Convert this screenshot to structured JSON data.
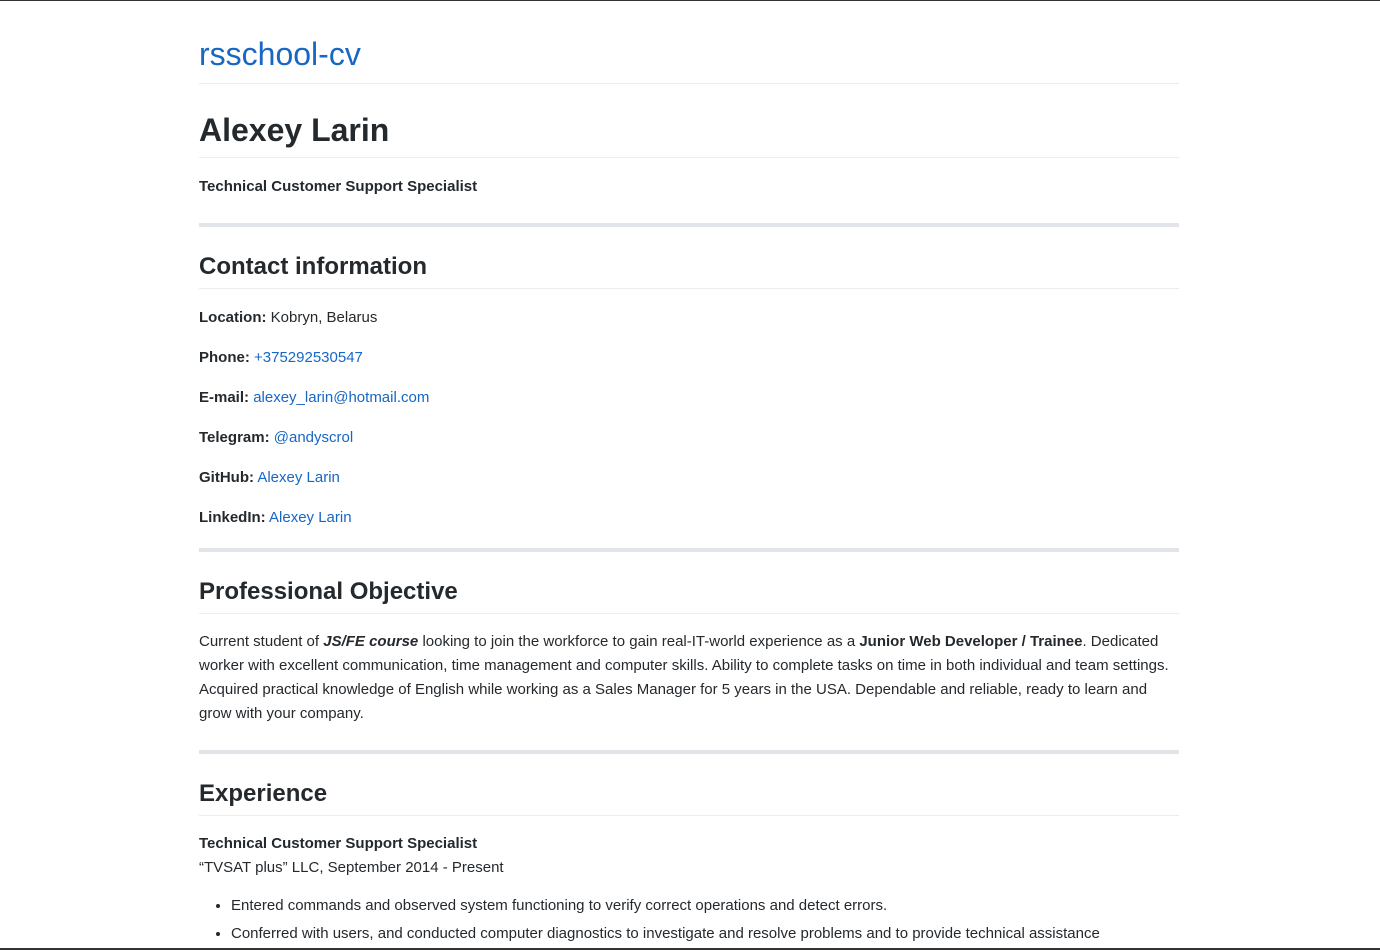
{
  "site": {
    "title": "rsschool-cv"
  },
  "header": {
    "name": "Alexey Larin",
    "subtitle": "Technical Customer Support Specialist"
  },
  "contact": {
    "heading": "Contact information",
    "location_label": "Location:",
    "location_value": "Kobryn, Belarus",
    "phone_label": "Phone:",
    "phone_value": "+375292530547",
    "email_label": "E-mail:",
    "email_value": "alexey_larin@hotmail.com",
    "telegram_label": "Telegram:",
    "telegram_value": "@andyscrol",
    "github_label": "GitHub:",
    "github_value": "Alexey Larin",
    "linkedin_label": "LinkedIn:",
    "linkedin_value": "Alexey Larin"
  },
  "objective": {
    "heading": "Professional Objective",
    "text_1": "Current student of ",
    "course": "JS/FE course",
    "text_2": " looking to join the workforce to gain real-IT-world experience as a ",
    "role": "Junior Web Developer / Trainee",
    "text_3": ". Dedicated worker with excellent communication, time management and computer skills. Ability to complete tasks on time in both individual and team settings. Acquired practical knowledge of English while working as a Sales Manager for 5 years in the USA. Dependable and reliable, ready to learn and grow with your company."
  },
  "experience": {
    "heading": "Experience",
    "job_title": "Technical Customer Support Specialist",
    "job_company": "“TVSAT plus” LLC, September 2014 - Present",
    "duties": [
      "Entered commands and observed system functioning to verify correct operations and detect errors.",
      "Conferred with users, and conducted computer diagnostics to investigate and resolve problems and to provide technical assistance"
    ]
  }
}
